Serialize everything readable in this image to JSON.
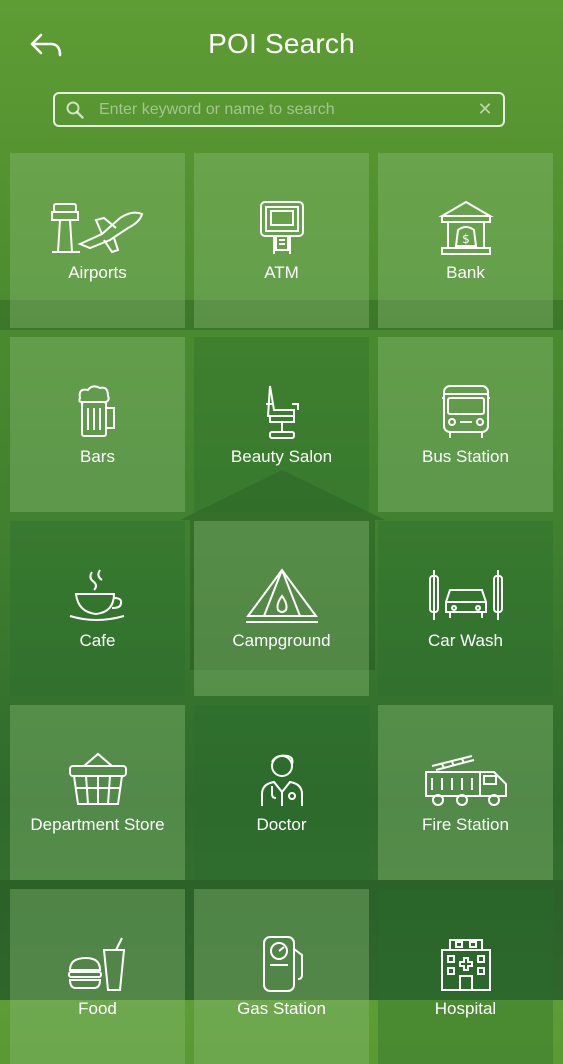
{
  "header": {
    "title": "POI Search"
  },
  "search": {
    "placeholder": "Enter keyword or name to search",
    "value": ""
  },
  "categories": [
    {
      "label": "Airports",
      "icon": "airport-icon"
    },
    {
      "label": "ATM",
      "icon": "atm-icon"
    },
    {
      "label": "Bank",
      "icon": "bank-icon"
    },
    {
      "label": "Bars",
      "icon": "beer-mug-icon"
    },
    {
      "label": "Beauty Salon",
      "icon": "salon-chair-icon"
    },
    {
      "label": "Bus Station",
      "icon": "bus-icon"
    },
    {
      "label": "Cafe",
      "icon": "coffee-cup-icon"
    },
    {
      "label": "Campground",
      "icon": "tent-icon"
    },
    {
      "label": "Car Wash",
      "icon": "car-wash-icon"
    },
    {
      "label": "Department Store",
      "icon": "basket-icon"
    },
    {
      "label": "Doctor",
      "icon": "doctor-icon"
    },
    {
      "label": "Fire Station",
      "icon": "fire-truck-icon"
    },
    {
      "label": "Food",
      "icon": "burger-drink-icon"
    },
    {
      "label": "Gas Station",
      "icon": "gas-pump-icon"
    },
    {
      "label": "Hospital",
      "icon": "hospital-icon"
    }
  ],
  "colors": {
    "background": "#4a8a30",
    "tile_light": "#8cbe78",
    "tile_dark": "#286e2d",
    "text": "#ffffff"
  }
}
